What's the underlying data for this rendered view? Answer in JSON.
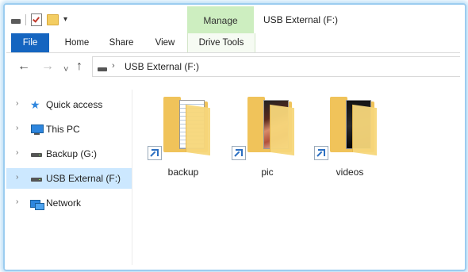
{
  "window": {
    "title": "USB External (F:)",
    "context_group": "Manage"
  },
  "ribbon": {
    "tabs": [
      {
        "label": "File"
      },
      {
        "label": "Home"
      },
      {
        "label": "Share"
      },
      {
        "label": "View"
      },
      {
        "label": "Drive Tools"
      }
    ],
    "quick_access_icons": [
      "drive-icon",
      "properties-check-icon",
      "new-folder-icon",
      "customize-dropdown-icon"
    ],
    "qat_dropdown_glyph": "▾"
  },
  "navigation": {
    "back_glyph": "←",
    "forward_glyph": "→",
    "recent_glyph": "˅",
    "up_glyph": "↑",
    "address": {
      "separator": "›",
      "path": "USB External (F:)"
    }
  },
  "sidebar": {
    "expand_glyph": "›",
    "items": [
      {
        "label": "Quick access",
        "icon": "star-icon",
        "selected": false
      },
      {
        "label": "This PC",
        "icon": "computer-icon",
        "selected": false
      },
      {
        "label": "Backup (G:)",
        "icon": "drive-icon",
        "selected": false
      },
      {
        "label": "USB External (F:)",
        "icon": "usb-drive-icon",
        "selected": true
      },
      {
        "label": "Network",
        "icon": "network-icon",
        "selected": false
      }
    ]
  },
  "content": {
    "items": [
      {
        "name": "backup",
        "type": "folder-shortcut",
        "preview": "document"
      },
      {
        "name": "pic",
        "type": "folder-shortcut",
        "preview": "photo"
      },
      {
        "name": "videos",
        "type": "folder-shortcut",
        "preview": "video"
      }
    ]
  },
  "colors": {
    "file_tab": "#1565c0",
    "manage_tab": "#cdeec0",
    "selected_item": "#cce8ff",
    "folder": "#f0c35a",
    "window_glow": "#9ccdf0"
  }
}
